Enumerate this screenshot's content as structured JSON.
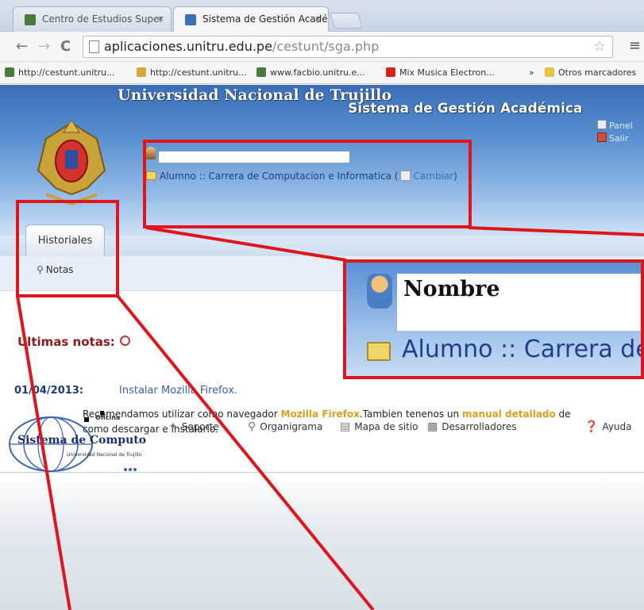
{
  "browser": {
    "tabs": [
      {
        "title": "Centro de Estudios Super",
        "close": "×",
        "active": false
      },
      {
        "title": "Sistema de Gestión Acadé",
        "close": "×",
        "active": true
      }
    ],
    "url_host": "aplicaciones.unitru.edu.pe",
    "url_path": "/cestunt/sga.php",
    "star_icon": "☆",
    "menu_icon": "≡",
    "bookmarks": [
      {
        "label": "http://cestunt.unitru...",
        "icon": "favicon-icon"
      },
      {
        "label": "http://cestunt.unitru...",
        "icon": "favicon-icon"
      },
      {
        "label": "www.facbio.unitru.e...",
        "icon": "favicon-icon"
      },
      {
        "label": "Mix Musica Electron...",
        "icon": "youtube-icon"
      }
    ],
    "more_bookmarks": "»",
    "other_bookmarks": "Otros marcadores"
  },
  "header": {
    "university": "Universidad Nacional de Trujillo",
    "system": "Sistema de Gestión Académica",
    "panel_link": "Panel",
    "exit_link": "Salir",
    "role_text": "Alumno :: Carrera de Computacion e Informatica (",
    "change_link": "Cambiar",
    "role_close": ")"
  },
  "nav": {
    "tab_label": "Historiales",
    "notas_label": "Notas"
  },
  "content": {
    "heading": "Ultimas notas:",
    "news_date": "01/04/2013:",
    "news_title": "Instalar Mozilla Firefox.",
    "body_part1": "Recomendamos utilizar como navegador ",
    "body_hl1": "Mozilla Firefox",
    "body_part2": ".Tambien tenenos un ",
    "body_hl2": "manual detallado",
    "body_part3": " de como descargar e instalarlo."
  },
  "footer": {
    "logo_top": "Oficina",
    "logo_title": "Sistema de Computo",
    "logo_sub": "Universidad Nacional de Trujillo",
    "links": [
      {
        "label": "Soporte",
        "icon": "tools-icon"
      },
      {
        "label": "Organigrama",
        "icon": "search-icon"
      },
      {
        "label": "Mapa de sitio",
        "icon": "sitemap-icon"
      },
      {
        "label": "Desarrolladores",
        "icon": "code-icon"
      },
      {
        "label": "Ayuda",
        "icon": "help-icon"
      }
    ]
  },
  "zoom": {
    "name": "Nombre",
    "role": "Alumno :: Carrera de Com"
  },
  "colors": {
    "annotation_red": "#e0141b",
    "header_blue": "#3a6fb8",
    "heading_red": "#8b1a1a",
    "highlight_gold": "#d9a01e"
  }
}
